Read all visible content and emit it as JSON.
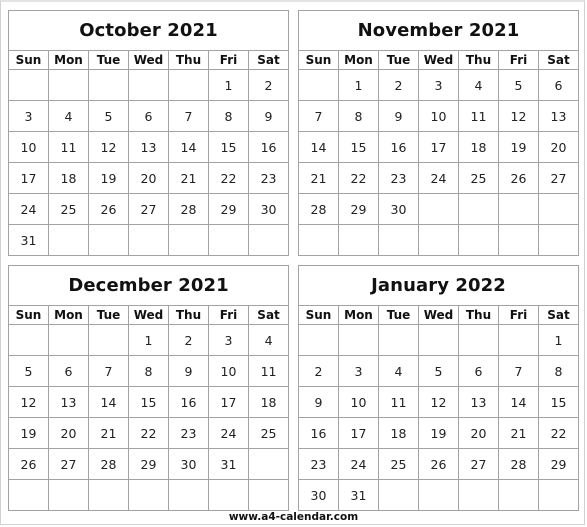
{
  "weekdays": [
    "Sun",
    "Mon",
    "Tue",
    "Wed",
    "Thu",
    "Fri",
    "Sat"
  ],
  "months": [
    {
      "title": "October 2021",
      "weeks": [
        [
          "",
          "",
          "",
          "",
          "",
          "1",
          "2"
        ],
        [
          "3",
          "4",
          "5",
          "6",
          "7",
          "8",
          "9"
        ],
        [
          "10",
          "11",
          "12",
          "13",
          "14",
          "15",
          "16"
        ],
        [
          "17",
          "18",
          "19",
          "20",
          "21",
          "22",
          "23"
        ],
        [
          "24",
          "25",
          "26",
          "27",
          "28",
          "29",
          "30"
        ],
        [
          "31",
          "",
          "",
          "",
          "",
          "",
          ""
        ]
      ]
    },
    {
      "title": "November 2021",
      "weeks": [
        [
          "",
          "1",
          "2",
          "3",
          "4",
          "5",
          "6"
        ],
        [
          "7",
          "8",
          "9",
          "10",
          "11",
          "12",
          "13"
        ],
        [
          "14",
          "15",
          "16",
          "17",
          "18",
          "19",
          "20"
        ],
        [
          "21",
          "22",
          "23",
          "24",
          "25",
          "26",
          "27"
        ],
        [
          "28",
          "29",
          "30",
          "",
          "",
          "",
          ""
        ],
        [
          "",
          "",
          "",
          "",
          "",
          "",
          ""
        ]
      ]
    },
    {
      "title": "December 2021",
      "weeks": [
        [
          "",
          "",
          "",
          "1",
          "2",
          "3",
          "4"
        ],
        [
          "5",
          "6",
          "7",
          "8",
          "9",
          "10",
          "11"
        ],
        [
          "12",
          "13",
          "14",
          "15",
          "16",
          "17",
          "18"
        ],
        [
          "19",
          "20",
          "21",
          "22",
          "23",
          "24",
          "25"
        ],
        [
          "26",
          "27",
          "28",
          "29",
          "30",
          "31",
          ""
        ],
        [
          "",
          "",
          "",
          "",
          "",
          "",
          ""
        ]
      ]
    },
    {
      "title": "January 2022",
      "weeks": [
        [
          "",
          "",
          "",
          "",
          "",
          "",
          "1"
        ],
        [
          "2",
          "3",
          "4",
          "5",
          "6",
          "7",
          "8"
        ],
        [
          "9",
          "10",
          "11",
          "12",
          "13",
          "14",
          "15"
        ],
        [
          "16",
          "17",
          "18",
          "19",
          "20",
          "21",
          "22"
        ],
        [
          "23",
          "24",
          "25",
          "26",
          "27",
          "28",
          "29"
        ],
        [
          "30",
          "31",
          "",
          "",
          "",
          "",
          ""
        ]
      ]
    }
  ],
  "footer": "www.a4-calendar.com"
}
